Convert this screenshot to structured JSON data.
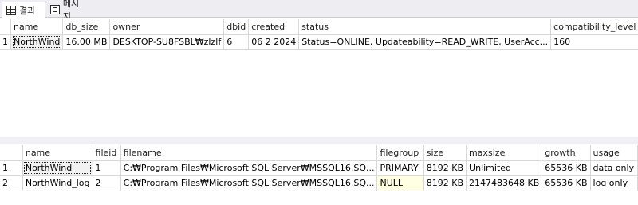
{
  "tabs": [
    {
      "label": "결과",
      "icon": "grid-icon"
    },
    {
      "label": "메시지",
      "icon": "message-icon"
    }
  ],
  "grid1": {
    "columns": [
      "name",
      "db_size",
      "owner",
      "dbid",
      "created",
      "status",
      "compatibility_level"
    ],
    "rows": [
      {
        "num": "1",
        "name": "NorthWind",
        "db_size": "16.00 MB",
        "owner": "DESKTOP-SU8FSBL₩zlzlf",
        "dbid": "6",
        "created": "06  2 2024",
        "status": "Status=ONLINE, Updateability=READ_WRITE, UserAcc...",
        "compatibility_level": "160"
      }
    ]
  },
  "grid2": {
    "columns": [
      "name",
      "fileid",
      "filename",
      "filegroup",
      "size",
      "maxsize",
      "growth",
      "usage"
    ],
    "rows": [
      {
        "num": "1",
        "name": "NorthWind",
        "fileid": "1",
        "filename": "C:₩Program Files₩Microsoft SQL Server₩MSSQL16.SQ...",
        "filegroup": "PRIMARY",
        "size": "8192 KB",
        "maxsize": "Unlimited",
        "growth": "65536 KB",
        "usage": "data only"
      },
      {
        "num": "2",
        "name": "NorthWind_log",
        "fileid": "2",
        "filename": "C:₩Program Files₩Microsoft SQL Server₩MSSQL16.SQ...",
        "filegroup": "NULL",
        "size": "8192 KB",
        "maxsize": "2147483648 KB",
        "growth": "65536 KB",
        "usage": "log only"
      }
    ]
  }
}
